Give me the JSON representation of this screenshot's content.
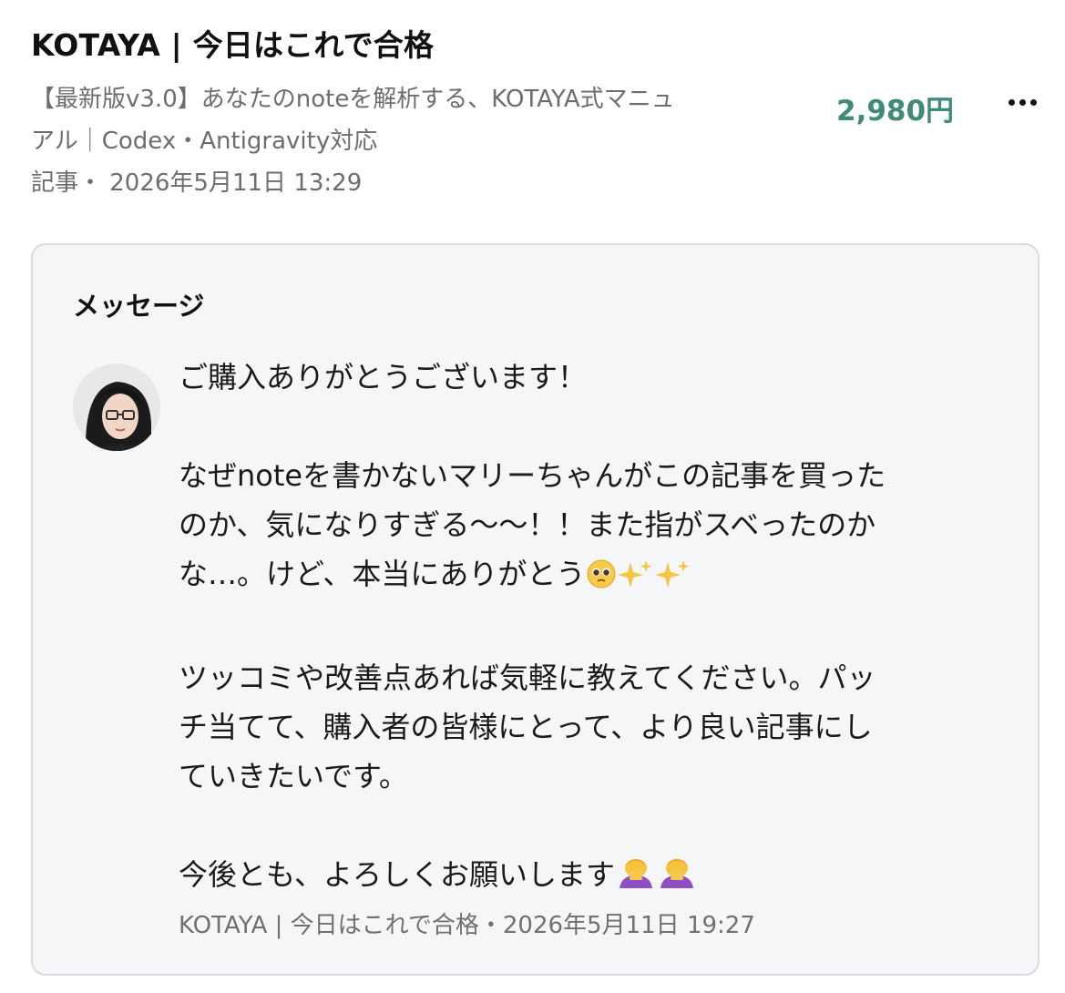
{
  "header": {
    "creator_title": "KOTAYA | 今日はこれで合格",
    "article_title_line1": "【最新版v3.0】あなたのnoteを解析する、KOTAYA式マニュ",
    "article_title_line2": "アル｜Codex・Antigravity対応",
    "article_meta": "記事・ 2026年5月11日 13:29",
    "price": "2,980円",
    "more_icon": "more-horizontal-icon"
  },
  "message": {
    "heading": "メッセージ",
    "avatar_icon": "avatar-portrait",
    "lines": {
      "l1": "ご購入ありがとうございます！",
      "l2": "なぜnoteを書かないマリーちゃんがこの記事を買った",
      "l3": "のか、気になりすぎる〜〜！！また指がスベったのか",
      "l4": "な…。けど、本当にありがとう",
      "l5": "ツッコミや改善点あれば気軽に教えてください。パッ",
      "l6": "チ当てて、購入者の皆様にとって、より良い記事にし",
      "l7": "ていきたいです。",
      "l8": "今後とも、よろしくお願いします"
    },
    "emoji_line4": [
      "pleading-face-emoji",
      "sparkles-emoji",
      "sparkles-emoji"
    ],
    "emoji_line8": [
      "person-bowing-emoji",
      "person-bowing-emoji"
    ],
    "footer": "KOTAYA | 今日はこれで合格・2026年5月11日 19:27"
  },
  "colors": {
    "price": "#3f8a78",
    "card_bg": "#f5f6f8",
    "card_border": "#d9dbe0",
    "muted_text": "#6d6d6d"
  }
}
